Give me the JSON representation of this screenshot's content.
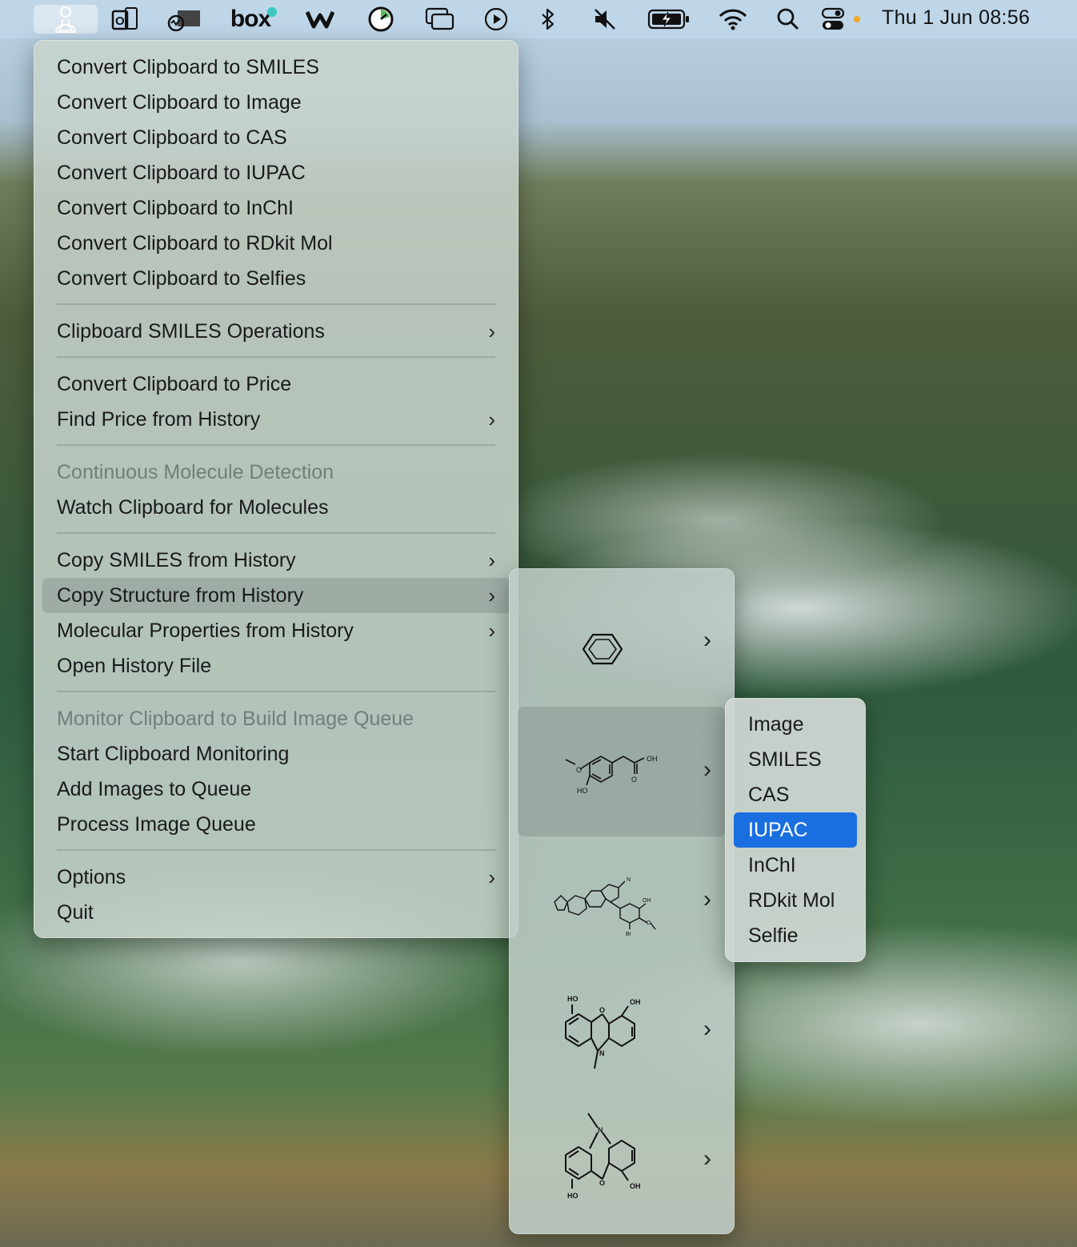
{
  "menubar": {
    "clock": "Thu 1 Jun  08:56",
    "box_label": "box",
    "icons": [
      "chemist-app-icon",
      "outlook-icon",
      "activity-monitor-icon",
      "box-icon",
      "webex-icon",
      "stopwatch-icon",
      "window-manager-icon",
      "play-icon",
      "bluetooth-icon",
      "mute-icon",
      "battery-charging-icon",
      "wifi-icon",
      "search-icon",
      "control-center-icon"
    ]
  },
  "main_menu": {
    "items": [
      {
        "label": "Convert Clipboard to SMILES"
      },
      {
        "label": "Convert Clipboard to Image"
      },
      {
        "label": "Convert Clipboard to CAS"
      },
      {
        "label": "Convert Clipboard to IUPAC"
      },
      {
        "label": "Convert Clipboard to InChI"
      },
      {
        "label": "Convert Clipboard to RDkit Mol"
      },
      {
        "label": "Convert Clipboard to Selfies"
      },
      {
        "label": "Clipboard SMILES Operations"
      },
      {
        "label": "Convert Clipboard to Price"
      },
      {
        "label": "Find Price from History"
      },
      {
        "label": "Continuous Molecule Detection"
      },
      {
        "label": "Watch Clipboard for Molecules"
      },
      {
        "label": "Copy SMILES from History"
      },
      {
        "label": "Copy Structure from History"
      },
      {
        "label": "Molecular Properties from History"
      },
      {
        "label": "Open History File"
      },
      {
        "label": "Monitor Clipboard to Build Image Queue"
      },
      {
        "label": "Start Clipboard Monitoring"
      },
      {
        "label": "Add Images to Queue"
      },
      {
        "label": "Process Image Queue"
      },
      {
        "label": "Options"
      },
      {
        "label": "Quit"
      }
    ]
  },
  "structure_menu": {
    "molecules": [
      {
        "atom_labels": []
      },
      {
        "atom_labels": [
          "OH",
          "HO",
          "O",
          "O"
        ]
      },
      {
        "atom_labels": [
          "OH",
          "N",
          "O",
          "Br"
        ]
      },
      {
        "atom_labels": [
          "HO",
          "OH",
          "O",
          "N"
        ]
      },
      {
        "atom_labels": [
          "N",
          "HO",
          "OH",
          "O"
        ]
      }
    ]
  },
  "format_menu": {
    "items": [
      "Image",
      "SMILES",
      "CAS",
      "IUPAC",
      "InChI",
      "RDkit Mol",
      "Selfie"
    ]
  },
  "colors": {
    "selection": "#1a6fe0"
  }
}
